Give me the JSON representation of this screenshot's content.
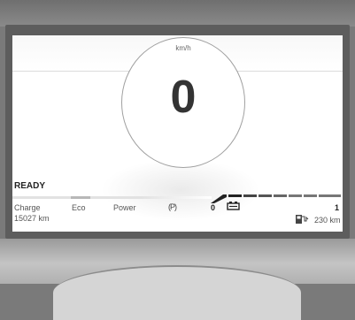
{
  "speedometer": {
    "unit": "km/h",
    "speed": "0"
  },
  "status": {
    "ready": "READY"
  },
  "power_meter": {
    "labels": [
      "Charge",
      "Eco",
      "Power"
    ],
    "odometer": "15027 km"
  },
  "gear": {
    "park_symbol": "(P)",
    "left_value": "0",
    "right_value": "1"
  },
  "range": {
    "value": "230 km"
  },
  "icons": [
    "park-brake-icon",
    "battery-icon",
    "fuel-pump-icon"
  ]
}
